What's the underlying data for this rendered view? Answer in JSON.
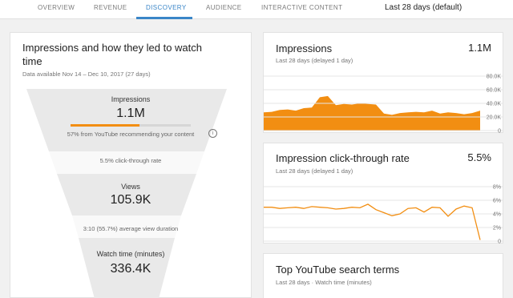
{
  "nav": {
    "tabs": [
      {
        "label": "OVERVIEW",
        "active": false
      },
      {
        "label": "REVENUE",
        "active": false
      },
      {
        "label": "DISCOVERY",
        "active": true
      },
      {
        "label": "AUDIENCE",
        "active": false
      },
      {
        "label": "INTERACTIVE CONTENT",
        "active": false
      }
    ],
    "date_range": "Last 28 days (default)"
  },
  "funnel_card": {
    "title": "Impressions and how they led to watch time",
    "subtitle": "Data available Nov 14 – Dec 10, 2017 (27 days)",
    "impressions_label": "Impressions",
    "impressions_value": "1.1M",
    "impressions_note": "57% from YouTube recommending your content",
    "impressions_progress_pct": 57,
    "ctr_note": "5.5% click-through rate",
    "views_label": "Views",
    "views_value": "105.9K",
    "avd_note": "3:10 (55.7%) average view duration",
    "watch_label": "Watch time (minutes)",
    "watch_value": "336.4K",
    "icon": "info-icon"
  },
  "impressions_card": {
    "title": "Impressions",
    "value": "1.1M",
    "subtitle": "Last 28 days (delayed 1 day)"
  },
  "ctr_card": {
    "title": "Impression click-through rate",
    "value": "5.5%",
    "subtitle": "Last 28 days (delayed 1 day)"
  },
  "search_card": {
    "title": "Top YouTube search terms",
    "subtitle": "Last 28 days · Watch time (minutes)"
  },
  "colors": {
    "accent": "#f28e12",
    "tab_active": "#3a86c8"
  },
  "chart_data": [
    {
      "type": "area",
      "title": "Impressions",
      "y_ticks": [
        "80.0K",
        "60.0K",
        "40.0K",
        "20.0K",
        "0"
      ],
      "ylim": [
        0,
        90000
      ],
      "x": [
        1,
        2,
        3,
        4,
        5,
        6,
        7,
        8,
        9,
        10,
        11,
        12,
        13,
        14,
        15,
        16,
        17,
        18,
        19,
        20,
        21,
        22,
        23,
        24,
        25,
        26,
        27,
        28
      ],
      "values": [
        30000,
        31000,
        34000,
        35000,
        33000,
        37000,
        38000,
        55000,
        57000,
        42000,
        44000,
        43000,
        45000,
        44000,
        43000,
        28000,
        26000,
        29000,
        30000,
        31000,
        30000,
        33000,
        28000,
        30000,
        29000,
        27000,
        29000,
        33000
      ]
    },
    {
      "type": "line",
      "title": "Impression click-through rate",
      "y_ticks": [
        "8%",
        "6%",
        "4%",
        "2%",
        "0"
      ],
      "ylim": [
        0,
        9
      ],
      "x": [
        1,
        2,
        3,
        4,
        5,
        6,
        7,
        8,
        9,
        10,
        11,
        12,
        13,
        14,
        15,
        16,
        17,
        18,
        19,
        20,
        21,
        22,
        23,
        24,
        25,
        26,
        27,
        28
      ],
      "values": [
        5.6,
        5.6,
        5.4,
        5.5,
        5.6,
        5.4,
        5.7,
        5.6,
        5.5,
        5.3,
        5.4,
        5.6,
        5.5,
        6.1,
        5.2,
        4.7,
        4.2,
        4.5,
        5.4,
        5.5,
        4.8,
        5.6,
        5.5,
        4.1,
        5.3,
        5.8,
        5.5,
        0.2
      ]
    }
  ]
}
